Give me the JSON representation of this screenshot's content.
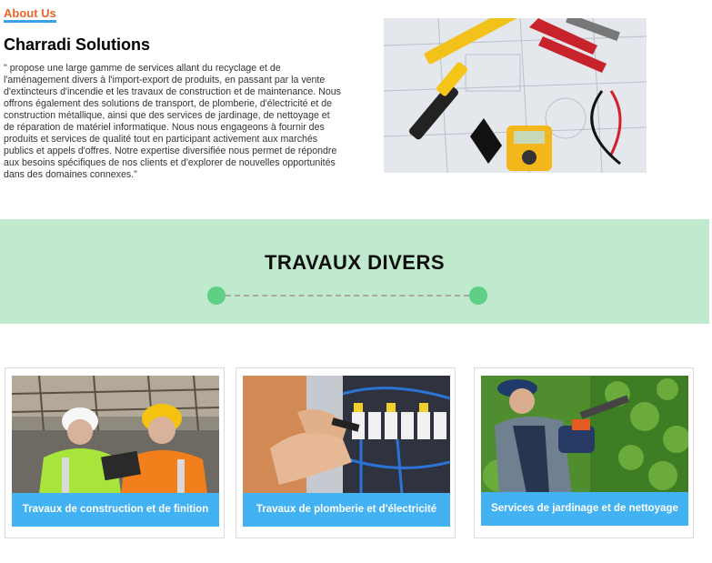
{
  "about": {
    "tag": "About Us",
    "company": "Charradi Solutions",
    "description": "\" propose une large gamme de services allant du recyclage et de l'aménagement divers à l'import-export de produits, en passant par la vente d'extincteurs d'incendie et les travaux de construction et de maintenance. Nous offrons également des solutions de transport, de plomberie, d'électricité et de construction métallique, ainsi que des services de jardinage, de nettoyage et de réparation de matériel informatique. Nous nous engageons à fournir des produits et services de qualité tout en participant activement aux marchés publics et appels d'offres. Notre expertise diversifiée nous permet de répondre aux besoins spécifiques de nos clients et d'explorer de nouvelles opportunités dans des domaines connexes.\""
  },
  "banner": {
    "title": "TRAVAUX DIVERS"
  },
  "services": [
    {
      "label": "Travaux de construction et de finition"
    },
    {
      "label": "Travaux de plomberie et d'électricité"
    },
    {
      "label": "Services de jardinage et de nettoyage"
    }
  ],
  "colors": {
    "accent_orange": "#e8652b",
    "accent_blue": "#42b2f2",
    "banner_green": "#bfeacd",
    "dot_green": "#5fcf86"
  }
}
